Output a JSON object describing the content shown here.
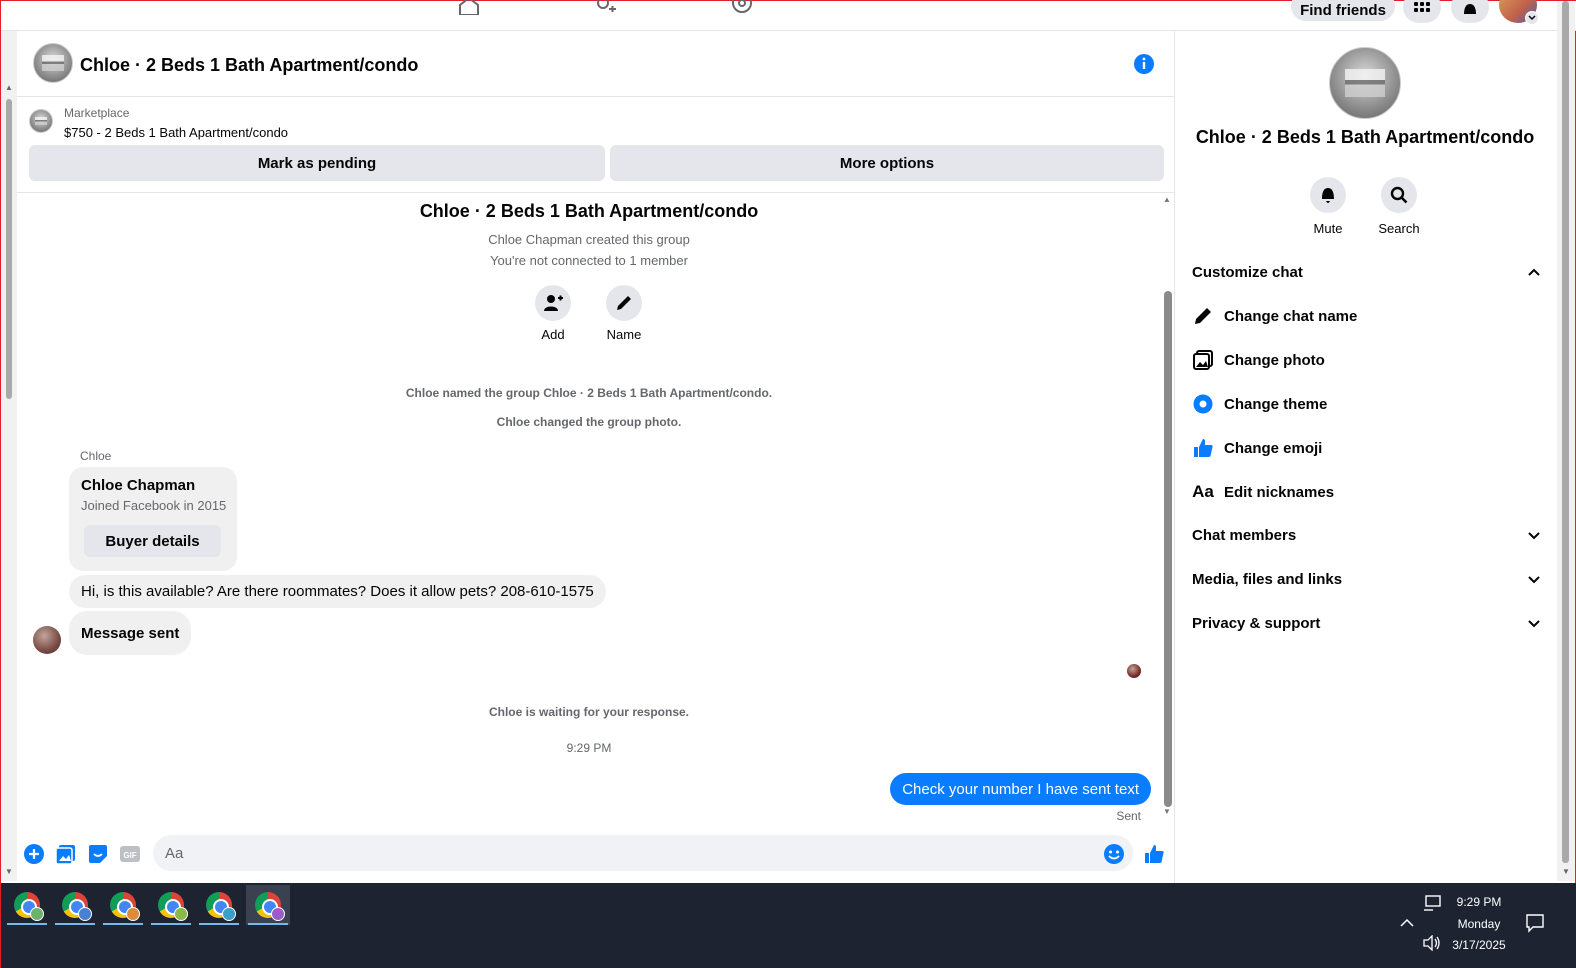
{
  "topnav": {
    "find_friends": "Find friends"
  },
  "header": {
    "title": "Chloe · 2 Beds 1 Bath Apartment/condo"
  },
  "marketplace": {
    "label": "Marketplace",
    "listing": "$750 - 2 Beds 1 Bath Apartment/condo",
    "mark_pending": "Mark as pending",
    "more_options": "More options"
  },
  "conversation": {
    "group_title": "Chloe · 2 Beds 1 Bath Apartment/condo",
    "created_by": "Chloe Chapman created this group",
    "not_connected": "You're not connected to 1 member",
    "add_label": "Add",
    "name_label": "Name",
    "event_named": "Chloe named the group Chloe · 2 Beds 1 Bath Apartment/condo.",
    "event_photo": "Chloe changed the group photo.",
    "sender": "Chloe",
    "card_name": "Chloe Chapman",
    "card_joined": "Joined Facebook in 2015",
    "buyer_details": "Buyer details",
    "message1": "Hi, is this available? Are there roommates? Does it allow pets? 208-610-1575",
    "message2": "Message sent",
    "waiting": "Chloe is waiting for your response.",
    "timestamp": "9:29 PM",
    "my_message": "Check your number I have sent text",
    "sent_status": "Sent"
  },
  "composer": {
    "placeholder": "Aa"
  },
  "right_panel": {
    "name": "Chloe · 2 Beds 1 Bath Apartment/condo",
    "mute": "Mute",
    "search": "Search",
    "customize_chat": "Customize chat",
    "items": [
      {
        "label": "Change chat name",
        "icon": "pencil-icon"
      },
      {
        "label": "Change photo",
        "icon": "photo-icon"
      },
      {
        "label": "Change theme",
        "icon": "theme-icon"
      },
      {
        "label": "Change emoji",
        "icon": "thumbs-up-icon"
      },
      {
        "label": "Edit nicknames",
        "icon": "text-aa-icon"
      }
    ],
    "chat_members": "Chat members",
    "media": "Media, files and links",
    "privacy": "Privacy & support"
  },
  "taskbar": {
    "time": "9:29 PM",
    "day": "Monday",
    "date": "3/17/2025"
  },
  "colors": {
    "accent": "#0a7cff",
    "taskbar": "#1d2330"
  }
}
